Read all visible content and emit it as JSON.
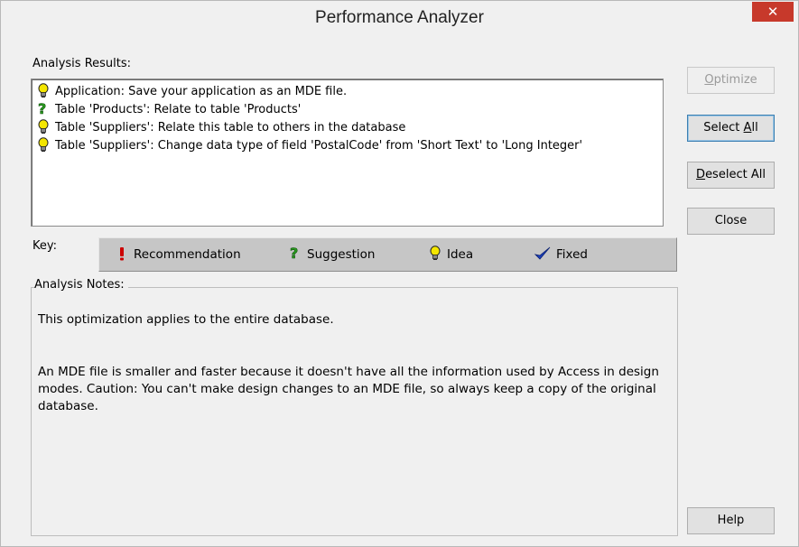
{
  "window": {
    "title": "Performance Analyzer",
    "close_glyph": "✕"
  },
  "labels": {
    "analysis_results": "Analysis Results:",
    "key": "Key:",
    "analysis_notes": "Analysis Notes:"
  },
  "results": [
    {
      "icon": "idea-icon",
      "text": "Application: Save your application as an MDE file."
    },
    {
      "icon": "suggestion-icon",
      "text": "Table 'Products': Relate to table 'Products'"
    },
    {
      "icon": "idea-icon",
      "text": "Table 'Suppliers': Relate this table to others in the database"
    },
    {
      "icon": "idea-icon",
      "text": "Table 'Suppliers': Change data type of field 'PostalCode' from 'Short Text' to 'Long Integer'"
    }
  ],
  "buttons": {
    "optimize": {
      "mnemonic": "O",
      "rest": "ptimize"
    },
    "select_all": {
      "prefix": "Select ",
      "mnemonic": "A",
      "rest": "ll"
    },
    "deselect_all": {
      "mnemonic": "D",
      "rest": "eselect All"
    },
    "close": "Close",
    "help": "Help"
  },
  "key": {
    "recommendation": "Recommendation",
    "suggestion": "Suggestion",
    "idea": "Idea",
    "fixed": "Fixed"
  },
  "notes": {
    "para1": "This optimization applies to the entire database.",
    "para2": "An MDE file is smaller and faster because it doesn't have all the information used by Access in design modes. Caution: You can't make design changes to an MDE file, so always keep a copy of the original database."
  },
  "colors": {
    "close_button": "#c7392b",
    "recommendation": "#cc0000",
    "suggestion": "#2a9b1f",
    "idea": "#e8d400",
    "fixed": "#1a3fb8"
  }
}
